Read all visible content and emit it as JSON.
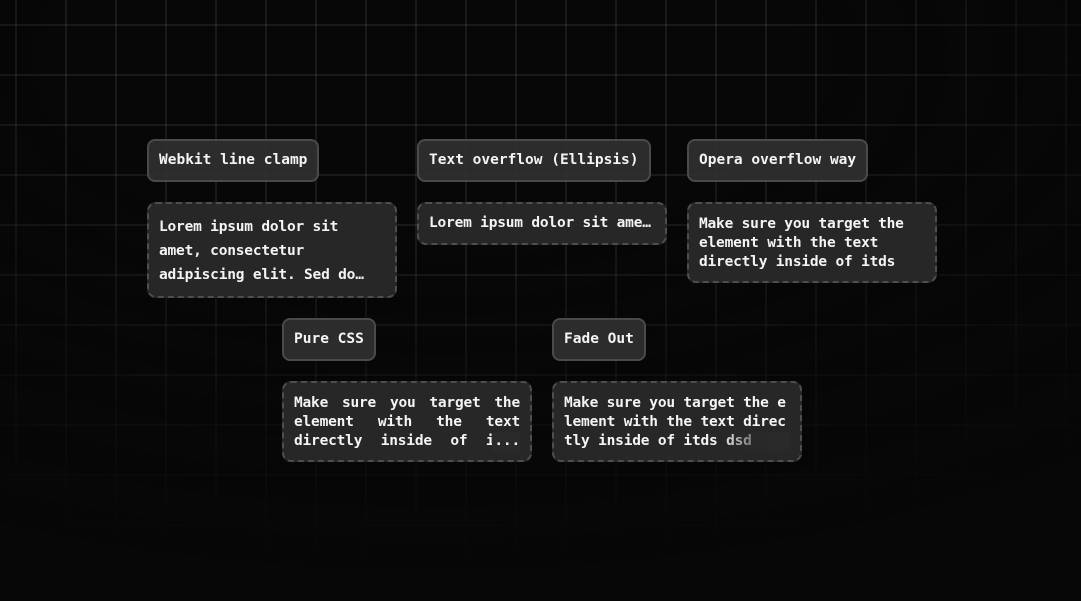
{
  "sections": [
    {
      "id": "clamp",
      "title": "Webkit line clamp",
      "text": "Lorem ipsum dolor sit amet, consectetur adipiscing elit. Sed do eiusmod tempor incididunt ut labore et dolore magna aliqua."
    },
    {
      "id": "ellipsis",
      "title": "Text overflow (Ellipsis)",
      "text": "Lorem ipsum dolor sit amet, consectetur adipiscing elit."
    },
    {
      "id": "opera",
      "title": "Opera overflow way",
      "text": "Make sure you target the element with the text directly inside of itds"
    },
    {
      "id": "purecss",
      "title": "Pure CSS",
      "text": "Make sure you target the element with the text directly inside of itds dsd",
      "more": "..."
    },
    {
      "id": "fade",
      "title": "Fade Out",
      "text": "Make sure you target the element with the text directly inside of itds dsd"
    }
  ],
  "theme": {
    "background": "#070707",
    "box_fill": "#2a2a2a",
    "box_border": "#4e4e4e",
    "text_color": "#f4f4f4"
  }
}
